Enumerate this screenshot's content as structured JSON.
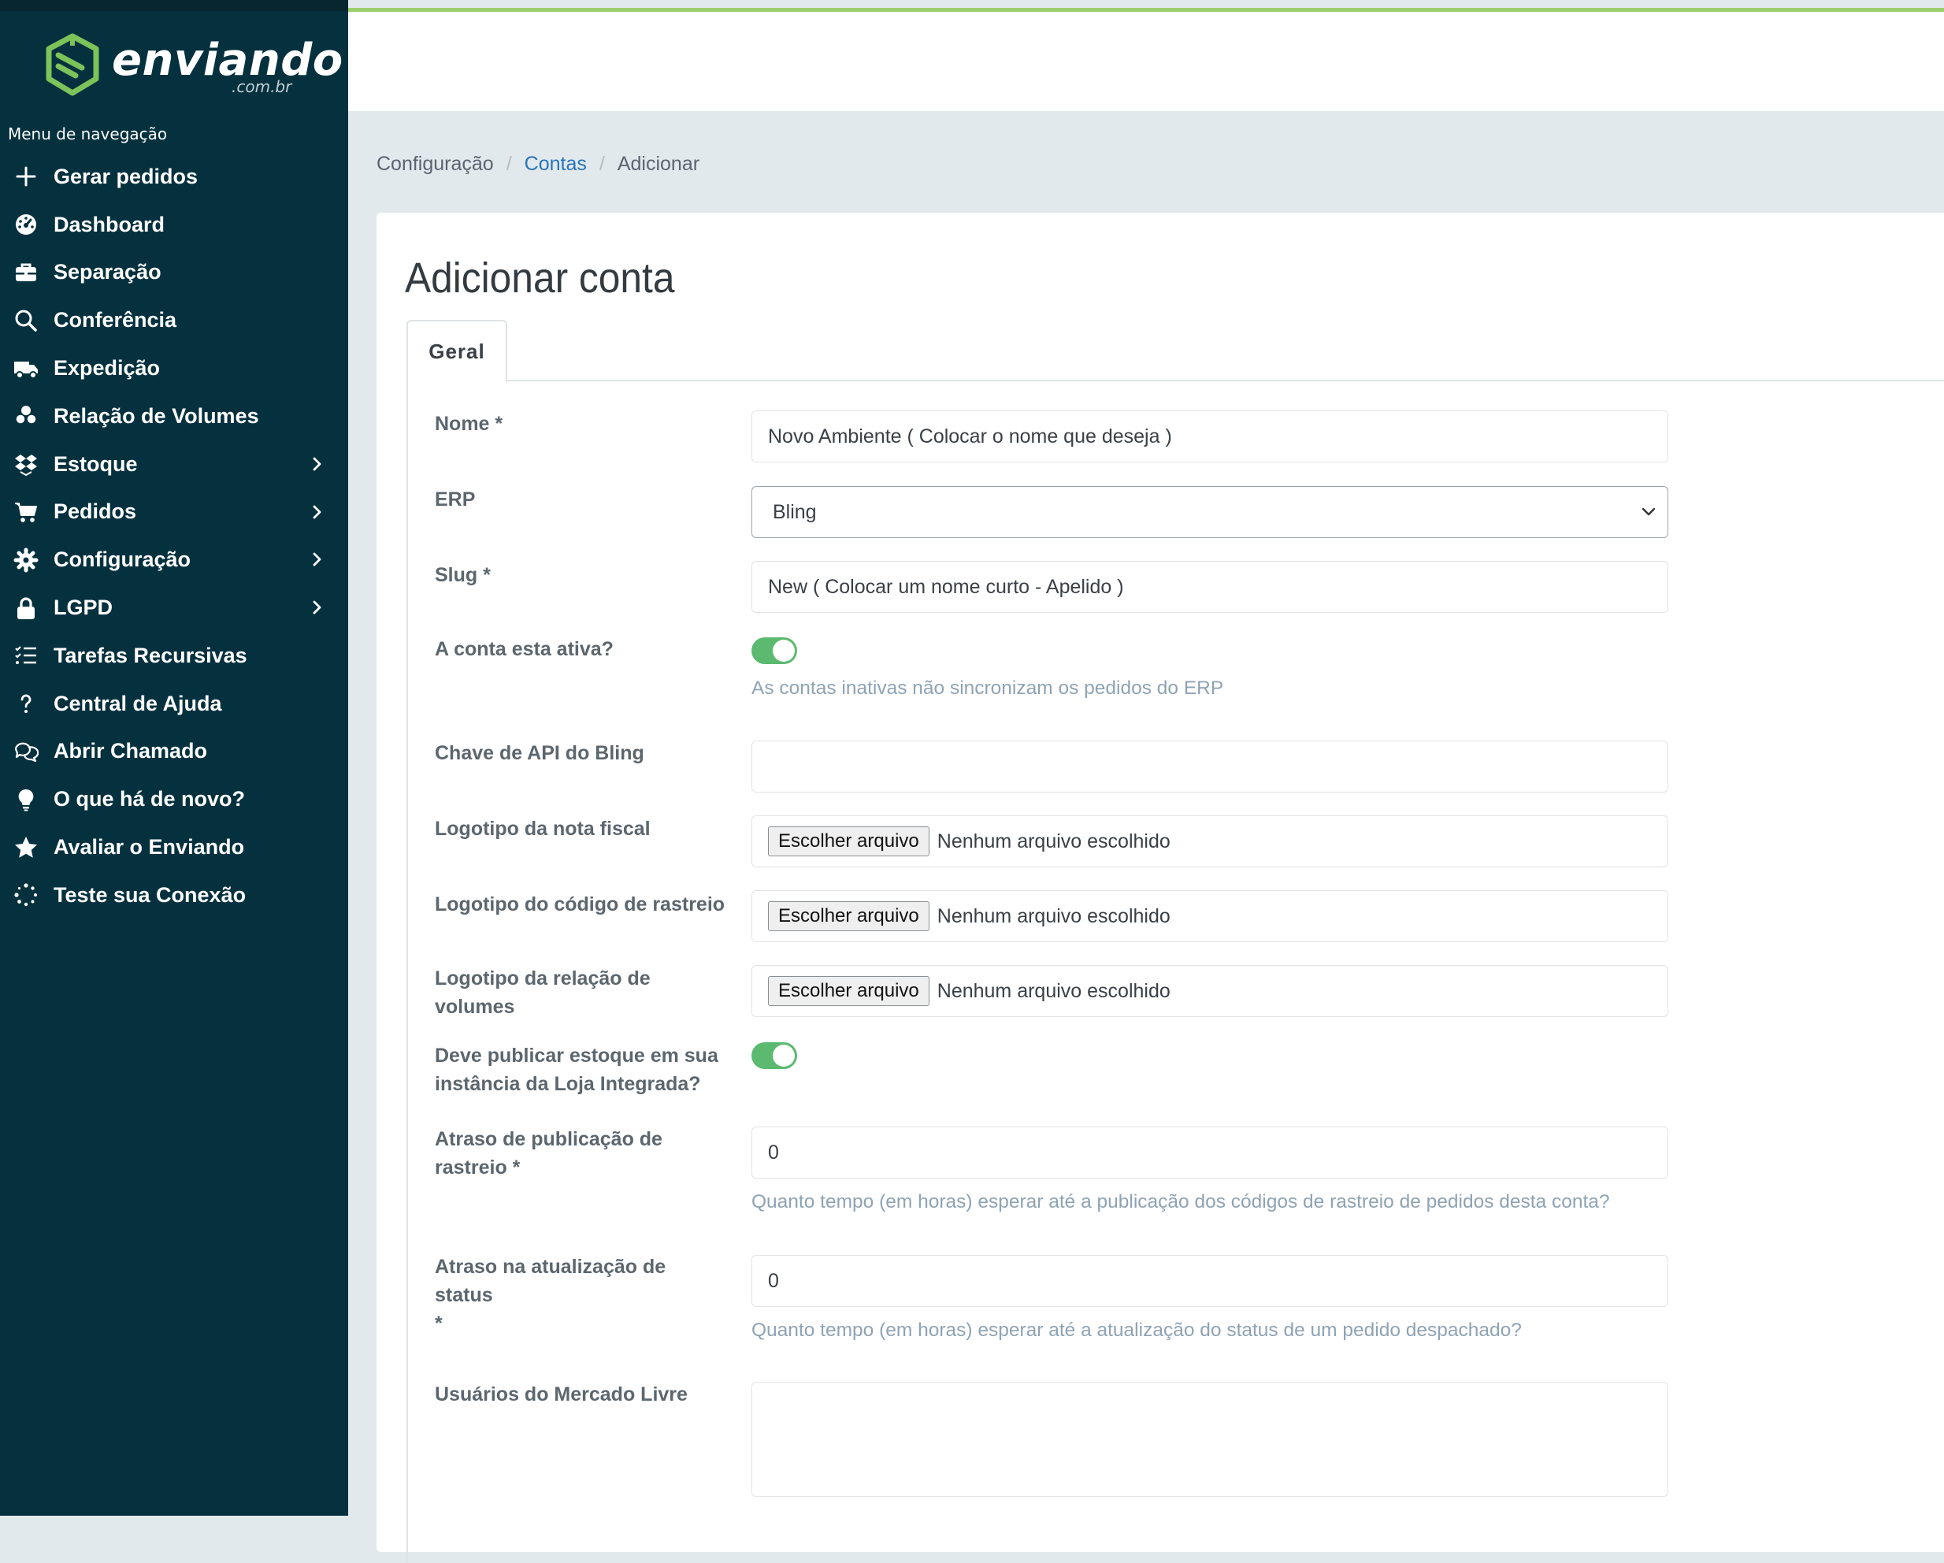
{
  "brand": {
    "name": "enviando",
    "domain": ".com.br"
  },
  "sidebar": {
    "heading": "Menu de navegação",
    "items": [
      {
        "label": "Gerar pedidos",
        "icon": "plus-icon",
        "has_children": false
      },
      {
        "label": "Dashboard",
        "icon": "gauge-icon",
        "has_children": false
      },
      {
        "label": "Separação",
        "icon": "briefcase-icon",
        "has_children": false
      },
      {
        "label": "Conferência",
        "icon": "search-icon",
        "has_children": false
      },
      {
        "label": "Expedição",
        "icon": "truck-icon",
        "has_children": false
      },
      {
        "label": "Relação de Volumes",
        "icon": "boxes-icon",
        "has_children": false
      },
      {
        "label": "Estoque",
        "icon": "dropbox-icon",
        "has_children": true
      },
      {
        "label": "Pedidos",
        "icon": "cart-icon",
        "has_children": true
      },
      {
        "label": "Configuração",
        "icon": "gear-icon",
        "has_children": true
      },
      {
        "label": "LGPD",
        "icon": "lock-icon",
        "has_children": true
      },
      {
        "label": "Tarefas Recursivas",
        "icon": "task-list-icon",
        "has_children": false
      },
      {
        "label": "Central de Ajuda",
        "icon": "question-icon",
        "has_children": false
      },
      {
        "label": "Abrir Chamado",
        "icon": "chat-bubbles-icon",
        "has_children": false
      },
      {
        "label": "O que há de novo?",
        "icon": "lightbulb-icon",
        "has_children": false
      },
      {
        "label": "Avaliar o Enviando",
        "icon": "star-icon",
        "has_children": false
      },
      {
        "label": "Teste sua Conexão",
        "icon": "spinner-icon",
        "has_children": false
      }
    ]
  },
  "breadcrumb": {
    "root": "Configuração",
    "parent": "Contas",
    "current": "Adicionar"
  },
  "page": {
    "title": "Adicionar conta",
    "tab": "Geral"
  },
  "form": {
    "nome": {
      "label": "Nome *",
      "value": "Novo Ambiente ( Colocar o nome que deseja )"
    },
    "erp": {
      "label": "ERP",
      "selected": "Bling"
    },
    "slug": {
      "label": "Slug *",
      "value": "New ( Colocar um nome curto - Apelido )"
    },
    "ativa": {
      "label": "A conta esta ativa?",
      "checked": true,
      "help": "As contas inativas não sincronizam os pedidos do ERP"
    },
    "api_key": {
      "label": "Chave de API do Bling",
      "value": ""
    },
    "logo_nota": {
      "label": "Logotipo da nota fiscal"
    },
    "logo_rastreio": {
      "label": "Logotipo do código de rastreio"
    },
    "logo_volumes": {
      "label": "Logotipo da relação de volumes"
    },
    "file_button": "Escolher arquivo",
    "file_none": "Nenhum arquivo escolhido",
    "publicar_estoque": {
      "label_line1": "Deve publicar estoque em sua",
      "label_line2": "instância da Loja Integrada?",
      "checked": true
    },
    "atraso_rastreio": {
      "label_line1": "Atraso de publicação de",
      "label_line2": "rastreio *",
      "value": "0",
      "help": "Quanto tempo (em horas) esperar até a publicação dos códigos de rastreio de pedidos desta conta?"
    },
    "atraso_status": {
      "label_line1": "Atraso na atualização de status",
      "label_line2": "*",
      "value": "0",
      "help": "Quanto tempo (em horas) esperar até a atualização do status de um pedido despachado?"
    },
    "usuarios_ml": {
      "label": "Usuários do Mercado Livre",
      "value": ""
    }
  },
  "colors": {
    "sidebar_bg": "#05313f",
    "accent_link": "#2874b8",
    "toggle_on": "#5bba6f",
    "brand_green": "#7cc35a"
  }
}
